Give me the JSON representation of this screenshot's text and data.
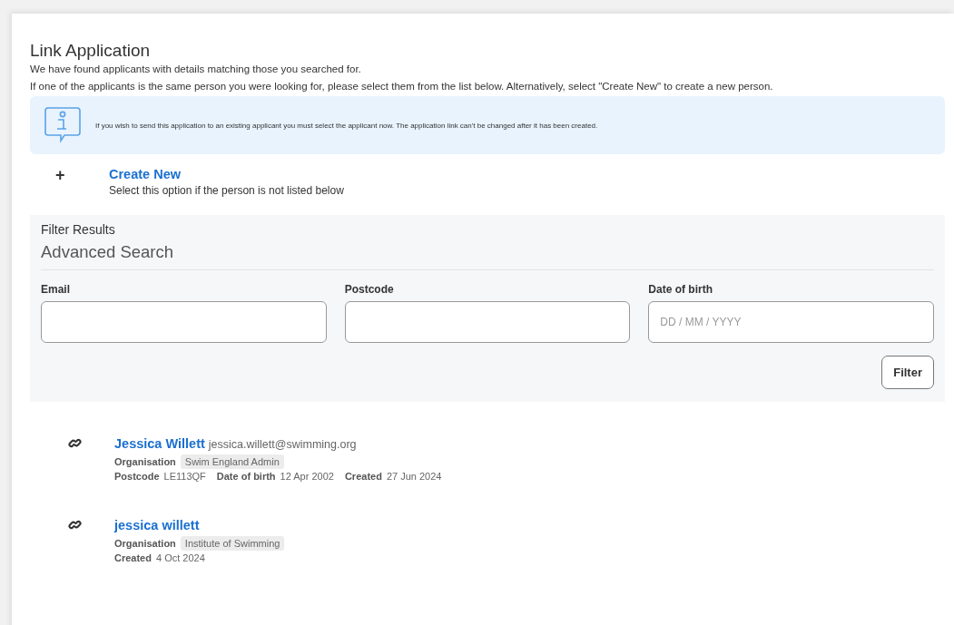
{
  "page": {
    "title": "Link Application",
    "intro": [
      "We have found applicants with details matching those you searched for.",
      "If one of the applicants is the same person you were looking for, please select them from the list below. Alternatively, select \"Create New\" to create a new person."
    ]
  },
  "notice": {
    "text": "If you wish to send this application to an existing applicant you must select the applicant now. The application link can't be changed after it has been created."
  },
  "create_new": {
    "icon": "+",
    "label": "Create New",
    "hint": "Select this option if the person is not listed below"
  },
  "filter": {
    "heading": "Filter Results",
    "title": "Advanced Search",
    "fields": [
      {
        "label": "Email"
      },
      {
        "label": "Postcode"
      },
      {
        "label": "Date of birth",
        "placeholder": "DD / MM / YYYY"
      }
    ],
    "button": "Filter"
  },
  "results": [
    {
      "name": "Jessica Willett",
      "email": "jessica.willett@swimming.org",
      "lines": [
        [
          {
            "label": "Organisation",
            "value": "Swim England Admin",
            "kind": "tag"
          }
        ],
        [
          {
            "label": "Postcode",
            "value": "LE113QF",
            "kind": "plain"
          },
          {
            "label": "Date of birth",
            "value": "12 Apr 2002",
            "kind": "plain"
          },
          {
            "label": "Created",
            "value": "27 Jun 2024",
            "kind": "plain"
          }
        ]
      ]
    },
    {
      "name": "jessica willett",
      "lines": [
        [
          {
            "label": "Organisation",
            "value": "Institute of Swimming",
            "kind": "tag"
          }
        ],
        [
          {
            "label": "Created",
            "value": "4 Oct 2024",
            "kind": "plain"
          }
        ]
      ]
    }
  ]
}
